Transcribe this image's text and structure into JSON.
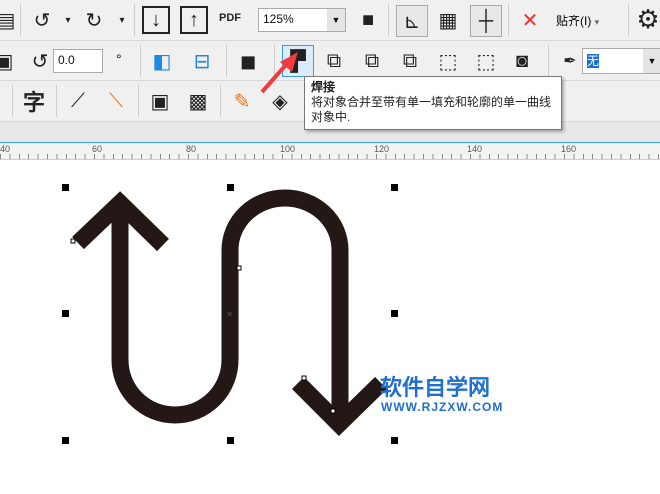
{
  "toolbar1": {
    "zoom_value": "125%",
    "snap_label": "贴齐(I)",
    "pdf_label": "PDF"
  },
  "toolbar2": {
    "rotation_value": "0.0",
    "degree_symbol": "°",
    "outline_value": "无"
  },
  "toolbar3": {
    "text_tool": "字"
  },
  "tooltip": {
    "title": "焊接",
    "body": "将对象合并至带有单一填充和轮廓的单一曲线对象中."
  },
  "ruler": {
    "ticks": [
      "40",
      "60",
      "80",
      "100",
      "120",
      "140",
      "160"
    ]
  },
  "watermark": {
    "title": "软件自学网",
    "url": "WWW.RJZXW.COM"
  },
  "colors": {
    "shape": "#231815",
    "accent": "#3c9be8",
    "watermark": "#1e6fd0",
    "arrow": "#f03c3c"
  }
}
